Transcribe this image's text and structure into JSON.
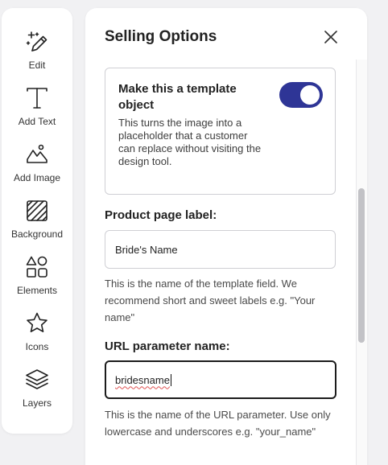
{
  "colors": {
    "accent": "#2e3596",
    "border": "#cfcfd4",
    "focus_border": "#1c1c1c"
  },
  "toolbar": {
    "items": [
      {
        "label": "Edit",
        "icon": "magic-pencil-icon"
      },
      {
        "label": "Add Text",
        "icon": "text-t-icon"
      },
      {
        "label": "Add Image",
        "icon": "mountain-image-icon"
      },
      {
        "label": "Background",
        "icon": "background-pattern-icon"
      },
      {
        "label": "Elements",
        "icon": "shapes-icon"
      },
      {
        "label": "Icons",
        "icon": "star-icon"
      },
      {
        "label": "Layers",
        "icon": "layers-icon"
      }
    ]
  },
  "panel": {
    "title": "Selling Options",
    "close_icon": "close-icon",
    "template": {
      "heading": "Make this a template object",
      "description": "This turns the image into a placeholder that a customer can replace without visiting the design tool.",
      "enabled": true
    },
    "product_label": {
      "label": "Product page label:",
      "value": "Bride's Name",
      "help": "This is the name of the template field. We recommend short and sweet labels e.g. \"Your name\""
    },
    "url_param": {
      "label": "URL parameter name:",
      "value": "bridesname",
      "help": "This is the name of the URL parameter. Use only lowercase and underscores e.g. \"your_name\""
    }
  }
}
